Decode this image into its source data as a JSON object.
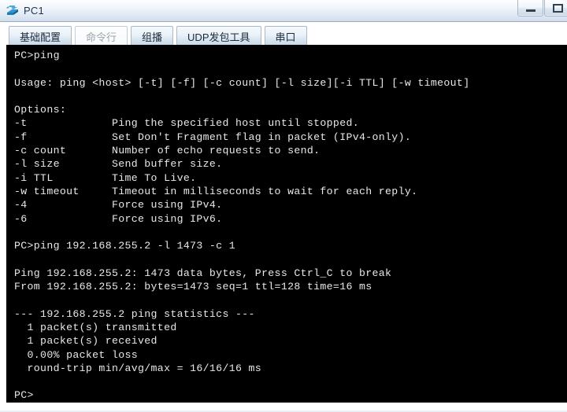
{
  "window": {
    "title": "PC1",
    "icon": "pc-device-icon",
    "controls": [
      {
        "name": "minimize-button",
        "glyph": "minimize-icon"
      },
      {
        "name": "maximize-button",
        "glyph": "maximize-icon"
      }
    ],
    "colors": {
      "titlebar_top": "#fdfeff",
      "titlebar_bottom": "#cfdcec",
      "terminal_bg": "#000000",
      "terminal_fg": "#e8e8e8",
      "tab_border": "#a9b8ca",
      "page_bg": "#eceff7"
    }
  },
  "tabs": [
    {
      "label": "基础配置",
      "active": false
    },
    {
      "label": "命令行",
      "active": true
    },
    {
      "label": "组播",
      "active": false
    },
    {
      "label": "UDP发包工具",
      "active": false
    },
    {
      "label": "串口",
      "active": false
    }
  ],
  "terminal": {
    "lines": [
      "PC>ping",
      "",
      "Usage: ping <host> [-t] [-f] [-c count] [-l size][-i TTL] [-w timeout]",
      "",
      "Options:",
      "-t             Ping the specified host until stopped.",
      "-f             Set Don't Fragment flag in packet (IPv4-only).",
      "-c count       Number of echo requests to send.",
      "-l size        Send buffer size.",
      "-i TTL         Time To Live.",
      "-w timeout     Timeout in milliseconds to wait for each reply.",
      "-4             Force using IPv4.",
      "-6             Force using IPv6.",
      "",
      "PC>ping 192.168.255.2 -l 1473 -c 1",
      "",
      "Ping 192.168.255.2: 1473 data bytes, Press Ctrl_C to break",
      "From 192.168.255.2: bytes=1473 seq=1 ttl=128 time=16 ms",
      "",
      "--- 192.168.255.2 ping statistics ---",
      "  1 packet(s) transmitted",
      "  1 packet(s) received",
      "  0.00% packet loss",
      "  round-trip min/avg/max = 16/16/16 ms",
      "",
      "PC>"
    ]
  }
}
